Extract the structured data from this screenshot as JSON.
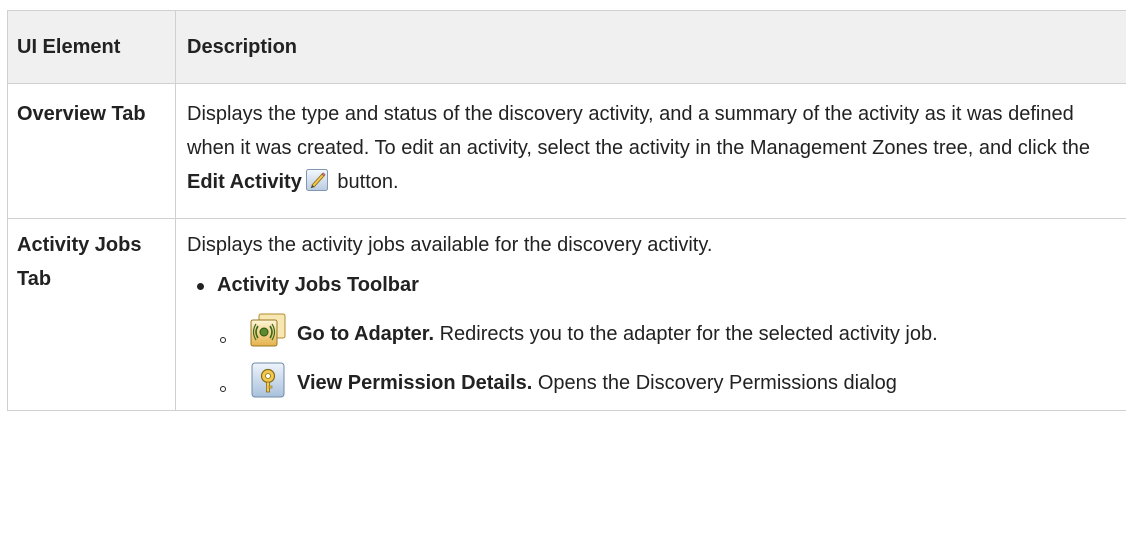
{
  "header": {
    "col1": "UI Element",
    "col2": "Description"
  },
  "rows": [
    {
      "label": "Overview Tab",
      "desc_text": "Displays the type and status of the discovery activity, and a summary of the activity as it was defined when it was created. To edit an activity, select the activity in the Management Zones tree, and click the ",
      "desc_bold": "Edit Activity",
      "desc_tail": " button.",
      "icon": "pencil-edit-icon"
    },
    {
      "label": "Activity Jobs Tab",
      "desc_text": "Displays the activity jobs available for the discovery activity.",
      "bullet": "Activity Jobs Toolbar",
      "items": [
        {
          "icon": "go-to-adapter-icon",
          "title": "Go to Adapter.",
          "text": " Redirects you to the adapter for the selected activity job."
        },
        {
          "icon": "view-permission-details-icon",
          "title": "View Permission Details.",
          "text": " Opens the Discovery Permissions dialog"
        }
      ]
    }
  ]
}
